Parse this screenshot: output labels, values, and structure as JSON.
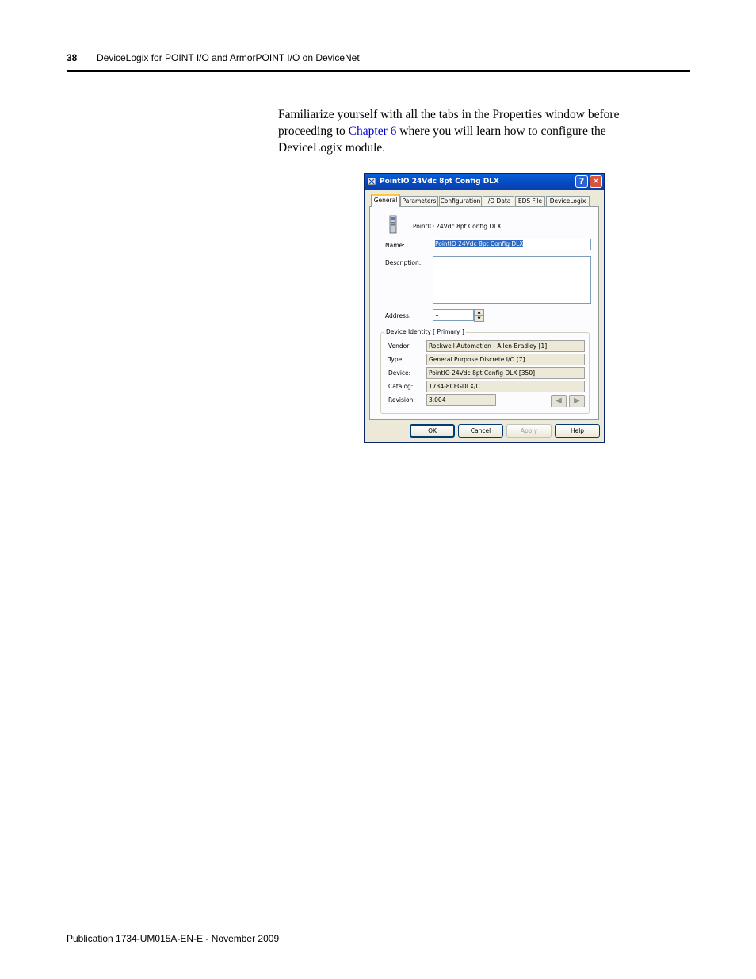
{
  "header": {
    "page_number": "38",
    "title": "DeviceLogix for POINT I/O and ArmorPOINT I/O on DeviceNet"
  },
  "body": {
    "text_before_link": "Familiarize yourself with all the tabs in the Properties window before proceeding to ",
    "link_text": "Chapter 6",
    "text_after_link": " where you will learn how to configure the DeviceLogix module."
  },
  "dialog": {
    "title": "PointIO 24Vdc 8pt Config DLX",
    "help_button": "?",
    "close_button": "✕",
    "tabs": [
      "General",
      "Parameters",
      "Configuration",
      "I/O Data",
      "EDS File",
      "DeviceLogix"
    ],
    "active_tab": "General",
    "device_label": "PointIO 24Vdc 8pt Config DLX",
    "name_label": "Name:",
    "name_value": "PointIO 24Vdc 8pt Config DLX",
    "description_label": "Description:",
    "description_value": "",
    "address_label": "Address:",
    "address_value": "1",
    "identity": {
      "legend": "Device Identity [ Primary ]",
      "vendor_label": "Vendor:",
      "vendor_value": "Rockwell Automation - Allen-Bradley [1]",
      "type_label": "Type:",
      "type_value": "General Purpose Discrete I/O [7]",
      "device_label": "Device:",
      "device_value": "PointIO 24Vdc 8pt Config DLX [350]",
      "catalog_label": "Catalog:",
      "catalog_value": "1734-8CFGDLX/C",
      "revision_label": "Revision:",
      "revision_value": "3.004"
    },
    "buttons": {
      "ok": "OK",
      "cancel": "Cancel",
      "apply": "Apply",
      "help": "Help"
    },
    "icons": {
      "app": "properties-icon",
      "device": "module-icon",
      "back": "arrow-left-icon",
      "forward": "arrow-right-icon"
    }
  },
  "footer": {
    "publication": "Publication 1734-UM015A-EN-E - November 2009"
  }
}
